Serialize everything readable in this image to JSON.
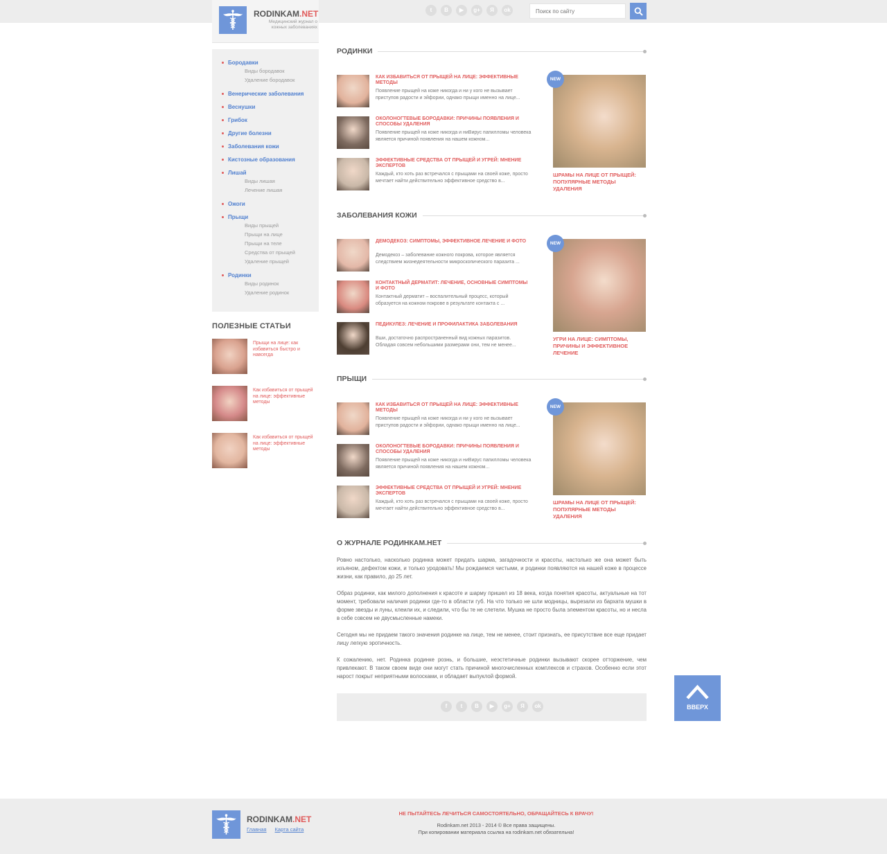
{
  "header": {
    "logo_name": "RODINKAM",
    "logo_tld": ".NET",
    "logo_tagline": "Медицинский журнал о кожных заболеваниях",
    "social": [
      {
        "icon": "twitter-icon",
        "glyph": "t"
      },
      {
        "icon": "vkontakte-icon",
        "glyph": "B"
      },
      {
        "icon": "youtube-icon",
        "glyph": "▶"
      },
      {
        "icon": "google-plus-icon",
        "glyph": "g+"
      },
      {
        "icon": "yandex-icon",
        "glyph": "Я"
      },
      {
        "icon": "odnoklassniki-icon",
        "glyph": "ok"
      }
    ],
    "search_placeholder": "Поиск по сайту"
  },
  "sidebar": {
    "menu": [
      {
        "label": "Бородавки",
        "subs": [
          "Виды бородавок",
          "Удаление бородавок"
        ]
      },
      {
        "label": "Венерические заболевания",
        "subs": []
      },
      {
        "label": "Веснушки",
        "subs": []
      },
      {
        "label": "Грибок",
        "subs": []
      },
      {
        "label": "Другие болезни",
        "subs": []
      },
      {
        "label": "Заболевания кожи",
        "subs": []
      },
      {
        "label": "Кистозные образования",
        "subs": []
      },
      {
        "label": "Лишай",
        "subs": [
          "Виды лишая",
          "Лечение лишая"
        ]
      },
      {
        "label": "Ожоги",
        "subs": []
      },
      {
        "label": "Прыщи",
        "subs": [
          "Виды прыщей",
          "Прыщи на лице",
          "Прыщи на теле",
          "Средства от прыщей",
          "Удаление прыщей"
        ]
      },
      {
        "label": "Родинки",
        "subs": [
          "Виды родинок",
          "Удаление родинок"
        ]
      }
    ],
    "useful_title": "ПОЛЕЗНЫЕ СТАТЬИ",
    "useful": [
      {
        "text": "Прыщи на лице: как избавиться быстро и навсегда",
        "thumb": "#d9a28f"
      },
      {
        "text": "Как избавиться от прыщей на лице: эффективные методы",
        "thumb": "#d58a8a"
      },
      {
        "text": "Как избавиться от прыщей на лице: эффективные методы",
        "thumb": "#e2b6a0"
      }
    ]
  },
  "sections": [
    {
      "title": "РОДИНКИ",
      "articles": [
        {
          "title": "Как избавиться от прыщей на лице: эффективные методы",
          "text": "Появление прыщей на коже никогда и ни у кого не вызывает приступов радости и эйфории, однако прыщи именно на лице...",
          "thumb": "#e1b29c"
        },
        {
          "title": "Околоногтевые бородавки: причины появления и способы удаления",
          "text": "Появление прыщей на коже никогда и ниВирус папилломы человека является причиной появления на нашем кожном...",
          "thumb": "#7d6a5f"
        },
        {
          "title": "Эффективные средства от прыщей и угрей: мнение экспертов",
          "text": "Каждый, кто хоть раз встречался с прыщами на своей коже, просто мечтает найти действительно эффективное средство в...",
          "thumb": "#c9b8a8"
        }
      ],
      "featured": {
        "badge": "NEW",
        "title": "Шрамы на лице от прыщей: популярные методы удаления",
        "img": "#d8b48f"
      }
    },
    {
      "title": "ЗАБОЛЕВАНИЯ КОЖИ",
      "articles": [
        {
          "title": "Демодекоз: симптомы, эффективное лечение и фото",
          "text": "Демодекоз – заболевание кожного покрова, которое является следствием жизнедеятельности микроскопического паразита ...",
          "thumb": "#e3b8a8"
        },
        {
          "title": "Контактный дерматит: лечение, основные симптомы и фото",
          "text": "Контактный дерматит – воспалительный процесс, который образуется на кожном покрове в результате контакта с ...",
          "thumb": "#d98a80"
        },
        {
          "title": "Педикулез: лечение и профилактика заболевания",
          "text": "Вши, достаточно распространенный вид кожных паразитов. Обладая совсем небольшими размерами они, тем не менее...",
          "thumb": "#4e3f33"
        }
      ],
      "featured": {
        "badge": "NEW",
        "title": "Угри на лице: симптомы, причины и эффективное лечение",
        "img": "#d7a590"
      }
    },
    {
      "title": "ПРЫЩИ",
      "articles": [
        {
          "title": "Как избавиться от прыщей на лице: эффективные методы",
          "text": "Появление прыщей на коже никогда и ни у кого не вызывает приступов радости и эйфории, однако прыщи именно на лице...",
          "thumb": "#e1b29c"
        },
        {
          "title": "Околоногтевые бородавки: причины появления и способы удаления",
          "text": "Появление прыщей на коже никогда и ниВирус папилломы человека является причиной появления на нашем кожном...",
          "thumb": "#7d6a5f"
        },
        {
          "title": "Эффективные средства от прыщей и угрей: мнение экспертов",
          "text": "Каждый, кто хоть раз встречался с прыщами на своей коже, просто мечтает найти действительно эффективное средство в...",
          "thumb": "#c9b8a8"
        }
      ],
      "featured": {
        "badge": "NEW",
        "title": "Шрамы на лице от прыщей: популярные методы удаления",
        "img": "#d8b48f"
      }
    }
  ],
  "about": {
    "title": "О ЖУРНАЛЕ РОДИНКАМ.НЕТ",
    "paragraphs": [
      "Ровно настолько, насколько родинка может придать шарма, загадочности и красоты, настолько же она может быть изъяном, дефектом кожи, и только уродовать! Мы рождаемся чистыми, и родинки появляются на нашей коже в процессе жизни, как правило, до 25 лет.",
      "Образ родинки, как милого дополнения к красоте и шарму пришел из 18 века, когда понятия красоты, актуальные на тот момент, требовали наличия родинки где-то в области губ. На что только не шли модницы, вырезали из бархата мушки в форме звезды и луны, клеили их, и следили, что бы те не слетели. Мушка не просто была элементом красоты, но и несла в себе совсем не двусмысленные намеки.",
      "Сегодня мы не придаем такого значения родинке на лице, тем не менее, стоит признать, ее присутствие все еще придает лицу легкую эротичность.",
      "К сожалению, нет. Родинка родинке рознь, и большие, неэстетичные родинки вызывают скорее отторжение, чем привлекают. В таком своем виде они могут стать причиной многочисленных комплексов и страхов. Особенно если этот нарост покрыт неприятными волосками, и обладает выпуклой формой."
    ]
  },
  "share": [
    {
      "icon": "facebook-icon",
      "glyph": "f"
    },
    {
      "icon": "twitter-icon",
      "glyph": "t"
    },
    {
      "icon": "vkontakte-icon",
      "glyph": "B"
    },
    {
      "icon": "youtube-icon",
      "glyph": "▶"
    },
    {
      "icon": "google-plus-icon",
      "glyph": "g+"
    },
    {
      "icon": "yandex-icon",
      "glyph": "Я"
    },
    {
      "icon": "odnoklassniki-icon",
      "glyph": "ok"
    }
  ],
  "up_button": {
    "label": "ВВЕРХ"
  },
  "footer": {
    "logo_name": "RODINKAM",
    "logo_tld": ".NET",
    "link_home": "Главная",
    "link_sitemap": "Карта сайта",
    "warning": "Не пытайтесь лечиться самостоятельно, обращайтесь к врачу!",
    "copyright": "Rodinkam.net 2013 - 2014 © Все права защищены.",
    "copy_note": "При копировании материала ссылка на rodinkam.net обязательна!"
  },
  "colors": {
    "accent_blue": "#6f96d9",
    "accent_red": "#e05a5a",
    "link_blue": "#4f7fcf"
  }
}
